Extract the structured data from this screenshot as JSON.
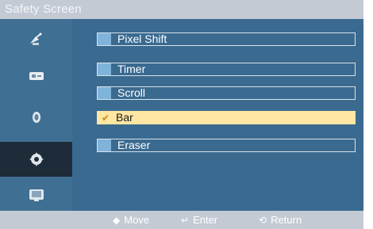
{
  "title": "Safety Screen",
  "sidebar": {
    "items": [
      {
        "icon": "satellite-dish-icon",
        "active": false
      },
      {
        "icon": "input-source-icon",
        "active": false
      },
      {
        "icon": "sound-icon",
        "active": false
      },
      {
        "icon": "setup-gear-icon",
        "active": true
      },
      {
        "icon": "multi-control-icon",
        "active": false
      }
    ]
  },
  "menu": {
    "items": [
      {
        "label": "Pixel Shift",
        "selected": false
      },
      {
        "label": "Timer",
        "selected": false
      },
      {
        "label": "Scroll",
        "selected": false
      },
      {
        "label": "Bar",
        "selected": true
      },
      {
        "label": "Eraser",
        "selected": false
      }
    ],
    "check_glyph": "✔"
  },
  "footer": {
    "move_label": "Move",
    "enter_label": "Enter",
    "return_label": "Return",
    "move_glyph": "◆",
    "enter_glyph": "↵",
    "return_glyph": "⟲"
  },
  "colors": {
    "title_bar": "#c4cad4",
    "sidebar_bg": "#3f6f93",
    "main_bg": "#3a6a90",
    "active_bg": "#1e2b38",
    "highlight": "#ffe6a3",
    "marker": "#7fb3da"
  }
}
